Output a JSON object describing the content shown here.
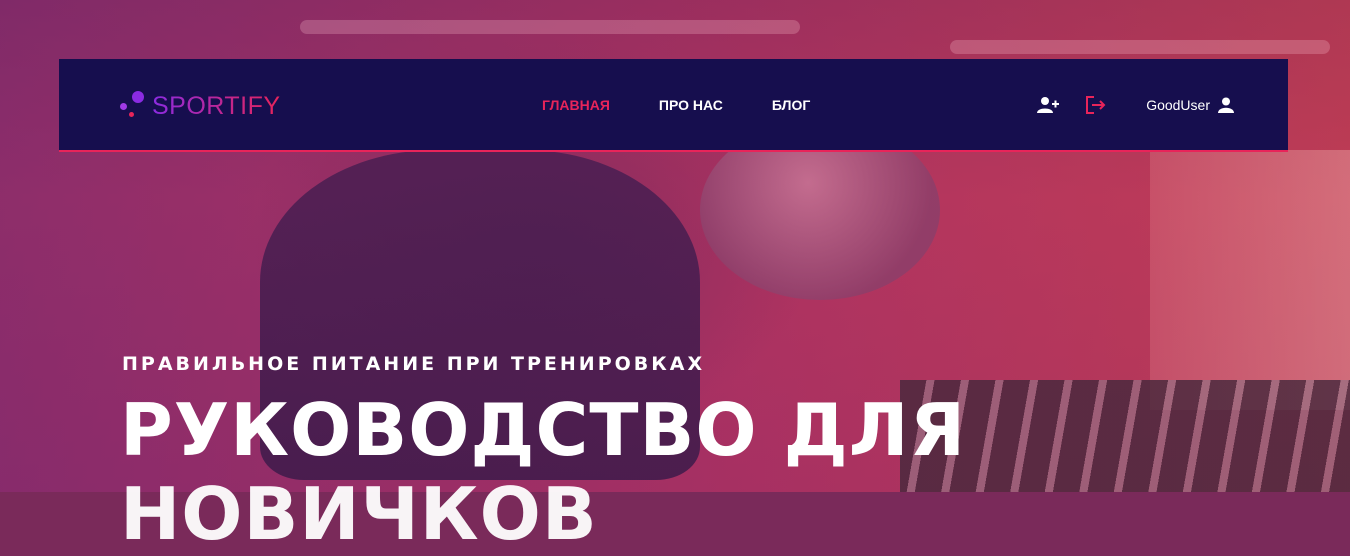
{
  "brand": {
    "name": "SPORTIFY"
  },
  "nav": {
    "links": [
      {
        "label": "ГЛАВНАЯ",
        "active": true
      },
      {
        "label": "ПРО НАС",
        "active": false
      },
      {
        "label": "БЛОГ",
        "active": false
      }
    ],
    "register_icon": "user-plus-icon",
    "logout_icon": "sign-out-icon",
    "user": {
      "name": "GoodUser",
      "icon": "user-icon"
    }
  },
  "hero": {
    "subtitle": "ПРАВИЛЬНОЕ ПИТАНИЕ ПРИ ТРЕНИРОВКАХ",
    "title_line1": "РУКОВОДСТВО ДЛЯ",
    "title_line2": "НОВИЧКОВ"
  },
  "colors": {
    "navbar_bg": "#160e4e",
    "accent": "#e8245a",
    "brand_purple": "#8b2be2"
  }
}
